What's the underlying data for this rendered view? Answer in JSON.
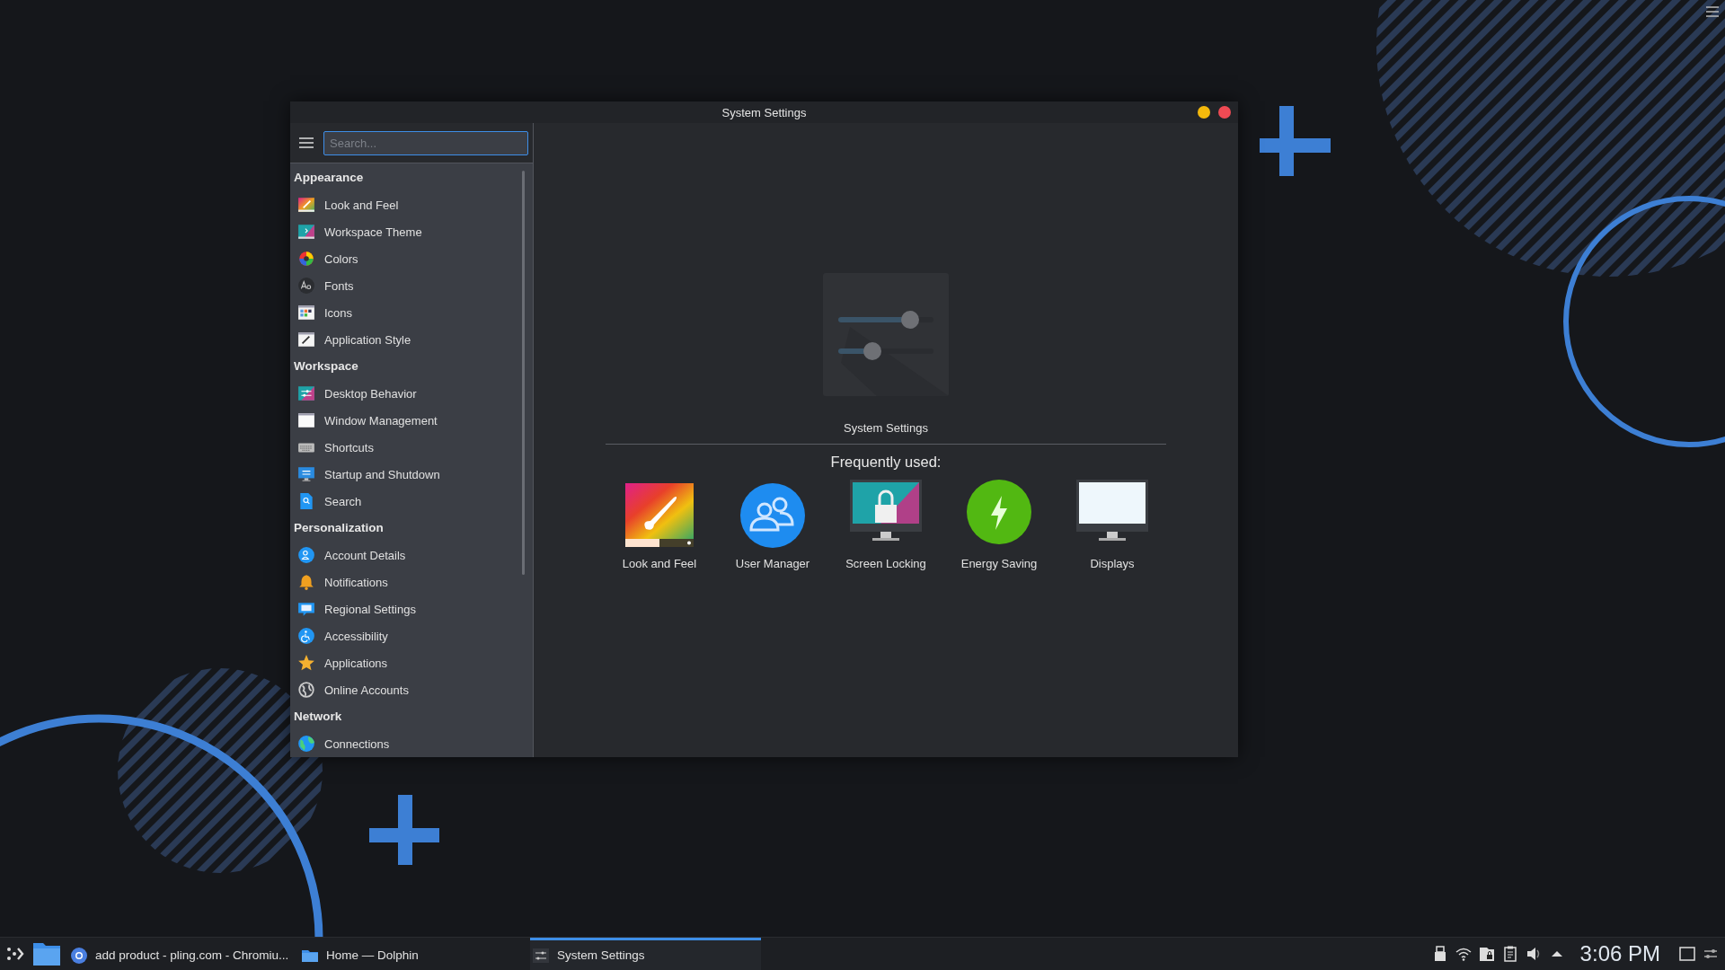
{
  "window": {
    "title": "System Settings"
  },
  "sidebar": {
    "search": {
      "placeholder": "Search..."
    },
    "sections": [
      {
        "title": "Appearance",
        "items": [
          {
            "label": "Look and Feel"
          },
          {
            "label": "Workspace Theme"
          },
          {
            "label": "Colors"
          },
          {
            "label": "Fonts"
          },
          {
            "label": "Icons"
          },
          {
            "label": "Application Style"
          }
        ]
      },
      {
        "title": "Workspace",
        "items": [
          {
            "label": "Desktop Behavior"
          },
          {
            "label": "Window Management"
          },
          {
            "label": "Shortcuts"
          },
          {
            "label": "Startup and Shutdown"
          },
          {
            "label": "Search"
          }
        ]
      },
      {
        "title": "Personalization",
        "items": [
          {
            "label": "Account Details"
          },
          {
            "label": "Notifications"
          },
          {
            "label": "Regional Settings"
          },
          {
            "label": "Accessibility"
          },
          {
            "label": "Applications"
          },
          {
            "label": "Online Accounts"
          }
        ]
      },
      {
        "title": "Network",
        "items": [
          {
            "label": "Connections"
          }
        ]
      }
    ]
  },
  "main": {
    "title": "System Settings",
    "frequent_heading": "Frequently used:",
    "frequent": [
      {
        "label": "Look and Feel"
      },
      {
        "label": "User Manager"
      },
      {
        "label": "Screen Locking"
      },
      {
        "label": "Energy Saving"
      },
      {
        "label": "Displays"
      }
    ]
  },
  "taskbar": {
    "tasks": [
      {
        "label": "add product - pling.com - Chromiu...",
        "selected": false
      },
      {
        "label": "Home — Dolphin",
        "selected": false
      },
      {
        "label": "System Settings",
        "selected": true
      }
    ],
    "clock": "3:06 PM"
  }
}
